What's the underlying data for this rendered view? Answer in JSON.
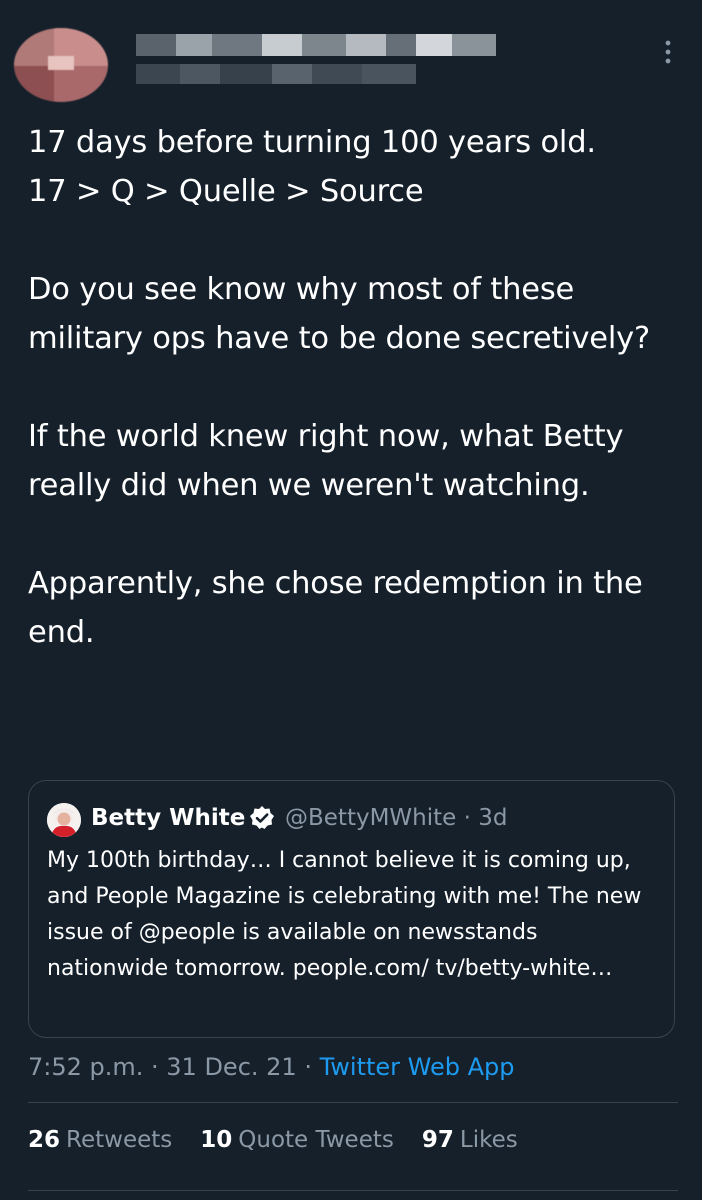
{
  "tweet": {
    "author_name_redacted": true,
    "body": "17 days before turning 100 years old.\n17 > Q > Quelle > Source\n\nDo you see know why most of these military ops have to be done secretively?\n\nIf the world knew right now, what Betty really did when we weren't watching.\n\nApparently, she chose redemption in the end."
  },
  "quoted_tweet": {
    "name": "Betty White",
    "handle_time": "@BettyMWhite · 3d",
    "text": "My 100th birthday… I cannot believe it is coming up, and People Magazine is celebrating with me! The new issue of @people is available on newsstands nationwide tomorrow. people.com/ tv/betty-white…"
  },
  "meta": {
    "time_date": "7:52 p.m. · 31 Dec. 21 · ",
    "source": "Twitter Web App"
  },
  "stats": {
    "retweets_count": "26",
    "retweets_label": "Retweets",
    "quotes_count": "10",
    "quotes_label": "Quote Tweets",
    "likes_count": "97",
    "likes_label": "Likes"
  },
  "icons": {
    "more": "more-vertical-icon",
    "verified": "verified-badge-icon"
  },
  "colors": {
    "background": "#15202b",
    "border": "#38444d",
    "secondary_text": "#8b98a5",
    "link": "#1d9bf0"
  }
}
